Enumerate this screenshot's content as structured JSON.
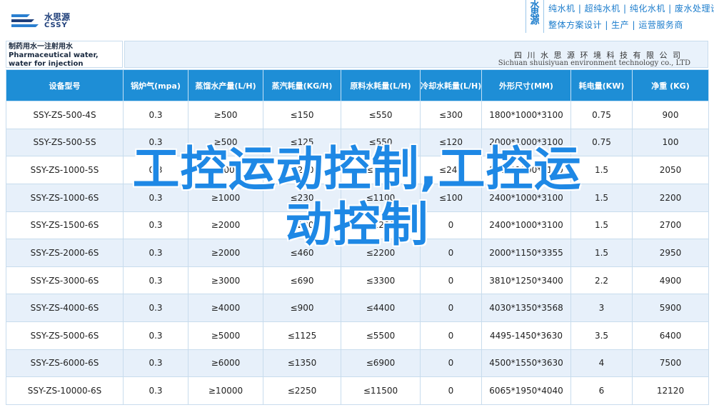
{
  "header": {
    "logo_cn": "水思源",
    "logo_en": "CSSY",
    "brand_vertical": "水思源",
    "tagline_1": "纯水机 | 超纯水机 | 纯化水机 | 废水处理设备",
    "tagline_2": "整体方案设计 | 生产 | 运营服务商"
  },
  "title_cell": {
    "line1": "制药用水一注射用水",
    "line2": "Pharmaceutical water, water for injection"
  },
  "company": {
    "cn": "四 川 水 思 源 环 境 科 技 有 限 公 司",
    "en": "Sichuan shuisiyuan environment technology co., LTD"
  },
  "table": {
    "headers": [
      "设备型号",
      "锅炉气(mpa)",
      "蒸馏水产量(L/H)",
      "蒸汽耗量(KG/H)",
      "原料水耗量(L/H)",
      "冷却水耗量(L/H)",
      "外形尺寸(MM)",
      "耗电量(KW)",
      "净重 (KG)"
    ],
    "rows": [
      [
        "SSY-ZS-500-4S",
        "0.3",
        "≥500",
        "≤150",
        "≤550",
        "≤300",
        "1800*1000*3100",
        "0.75",
        "900"
      ],
      [
        "SSY-ZS-500-5S",
        "0.3",
        "≥500",
        "≤125",
        "≤550",
        "≤120",
        "2000*1000*3100",
        "0.75",
        "100"
      ],
      [
        "SSY-ZS-1000-5S",
        "0.3",
        "≥1000",
        "≤250",
        "≤1100",
        "≤240",
        "2000*1000*3100",
        "1.5",
        "2050"
      ],
      [
        "SSY-ZS-1000-6S",
        "0.3",
        "≥1000",
        "≤230",
        "≤1100",
        "≤100",
        "2400*1000*3100",
        "1.5",
        "2200"
      ],
      [
        "SSY-ZS-1500-6S",
        "0.3",
        "≥2000",
        "≤230",
        "≤2200",
        "0",
        "2400*1000*3100",
        "1.5",
        "2700"
      ],
      [
        "SSY-ZS-2000-6S",
        "0.3",
        "≥2000",
        "≤460",
        "≤2200",
        "0",
        "2000*1150*3355",
        "1.5",
        "2950"
      ],
      [
        "SSY-ZS-3000-6S",
        "0.3",
        "≥3000",
        "≤690",
        "≤3300",
        "0",
        "3810*1250*3400",
        "2.2",
        "4900"
      ],
      [
        "SSY-ZS-4000-6S",
        "0.3",
        "≥4000",
        "≤900",
        "≤4400",
        "0",
        "4030*1350*3568",
        "3",
        "5900"
      ],
      [
        "SSY-ZS-5000-6S",
        "0.3",
        "≥5000",
        "≤1125",
        "≤5500",
        "0",
        "4495-1450*3630",
        "3.5",
        "6400"
      ],
      [
        "SSY-ZS-6000-6S",
        "0.3",
        "≥6000",
        "≤1350",
        "≤6900",
        "0",
        "4500*1550*3630",
        "4",
        "7500"
      ],
      [
        "SSY-ZS-10000-6S",
        "0.3",
        "≥10000",
        "≤2250",
        "≤11500",
        "0",
        "6065*1950*4040",
        "6",
        "12120"
      ]
    ]
  },
  "overlay": {
    "line1": "工控运动控制,工控运",
    "line2": "动控制"
  },
  "colors": {
    "header_blue": "#1e8ed6",
    "row_alt": "#e7f0fa",
    "overlay_blue": "#1e88e5",
    "brand_navy": "#1f3f7a"
  }
}
